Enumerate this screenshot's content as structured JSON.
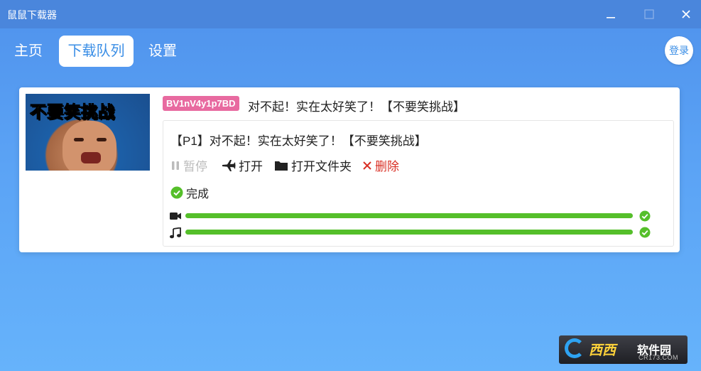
{
  "window": {
    "title": "鼠鼠下载器"
  },
  "nav": {
    "tabs": [
      {
        "label": "主页",
        "active": false
      },
      {
        "label": "下载队列",
        "active": true
      },
      {
        "label": "设置",
        "active": false
      }
    ],
    "login_label": "登录"
  },
  "download": {
    "thumbnail_text": "不要笑挑战",
    "bvid": "BV1nV4y1p7BD",
    "title": "对不起！实在太好笑了！【不要笑挑战】",
    "part": {
      "title": "【P1】对不起！实在太好笑了！【不要笑挑战】",
      "actions": {
        "pause": "暂停",
        "open": "打开",
        "open_folder": "打开文件夹",
        "delete": "删除"
      },
      "status": "完成",
      "progress": {
        "video": 1.0,
        "audio": 1.0
      }
    }
  },
  "watermark": {
    "brand": "西西",
    "suffix": "软件园",
    "url": "CR173.COM"
  },
  "colors": {
    "accent": "#3a8ee6",
    "badge": "#e86aa0",
    "progress": "#55bf2a",
    "delete": "#d93025"
  }
}
